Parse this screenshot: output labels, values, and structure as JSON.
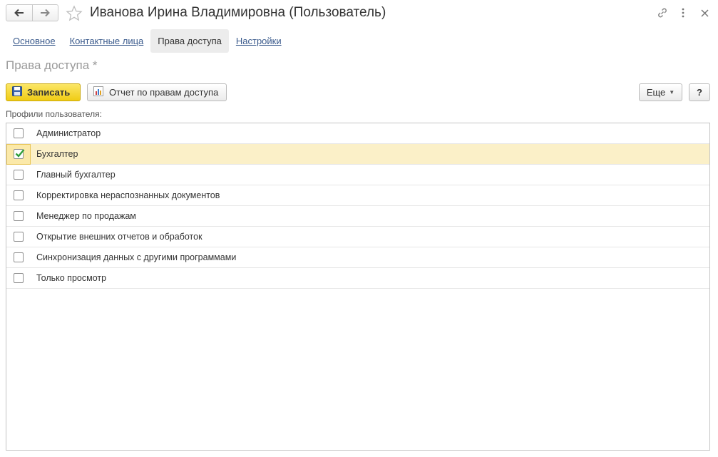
{
  "window": {
    "title": "Иванова Ирина Владимировна (Пользователь)"
  },
  "tabs": [
    {
      "label": "Основное",
      "active": false
    },
    {
      "label": "Контактные лица",
      "active": false
    },
    {
      "label": "Права доступа",
      "active": true
    },
    {
      "label": "Настройки",
      "active": false
    }
  ],
  "section": {
    "title": "Права доступа *"
  },
  "toolbar": {
    "save_label": "Записать",
    "report_label": "Отчет по правам доступа",
    "more_label": "Еще",
    "help_label": "?"
  },
  "profiles": {
    "label": "Профили пользователя:",
    "items": [
      {
        "label": "Администратор",
        "checked": false,
        "selected": false
      },
      {
        "label": "Бухгалтер",
        "checked": true,
        "selected": true
      },
      {
        "label": "Главный бухгалтер",
        "checked": false,
        "selected": false
      },
      {
        "label": "Корректировка нераспознанных документов",
        "checked": false,
        "selected": false
      },
      {
        "label": "Менеджер по продажам",
        "checked": false,
        "selected": false
      },
      {
        "label": "Открытие внешних отчетов и обработок",
        "checked": false,
        "selected": false
      },
      {
        "label": "Синхронизация данных с другими программами",
        "checked": false,
        "selected": false
      },
      {
        "label": "Только просмотр",
        "checked": false,
        "selected": false
      }
    ]
  },
  "colors": {
    "accent_yellow": "#f0cc14",
    "link": "#3a5a8c",
    "selected_row": "#fbf0c8",
    "check_green": "#2e9e3a"
  },
  "icons": {
    "back": "arrow-left-icon",
    "forward": "arrow-right-icon",
    "favorite": "star-icon",
    "link": "link-icon",
    "menu": "more-vertical-icon",
    "close": "close-icon",
    "save": "floppy-disk-icon",
    "report": "report-chart-icon"
  }
}
